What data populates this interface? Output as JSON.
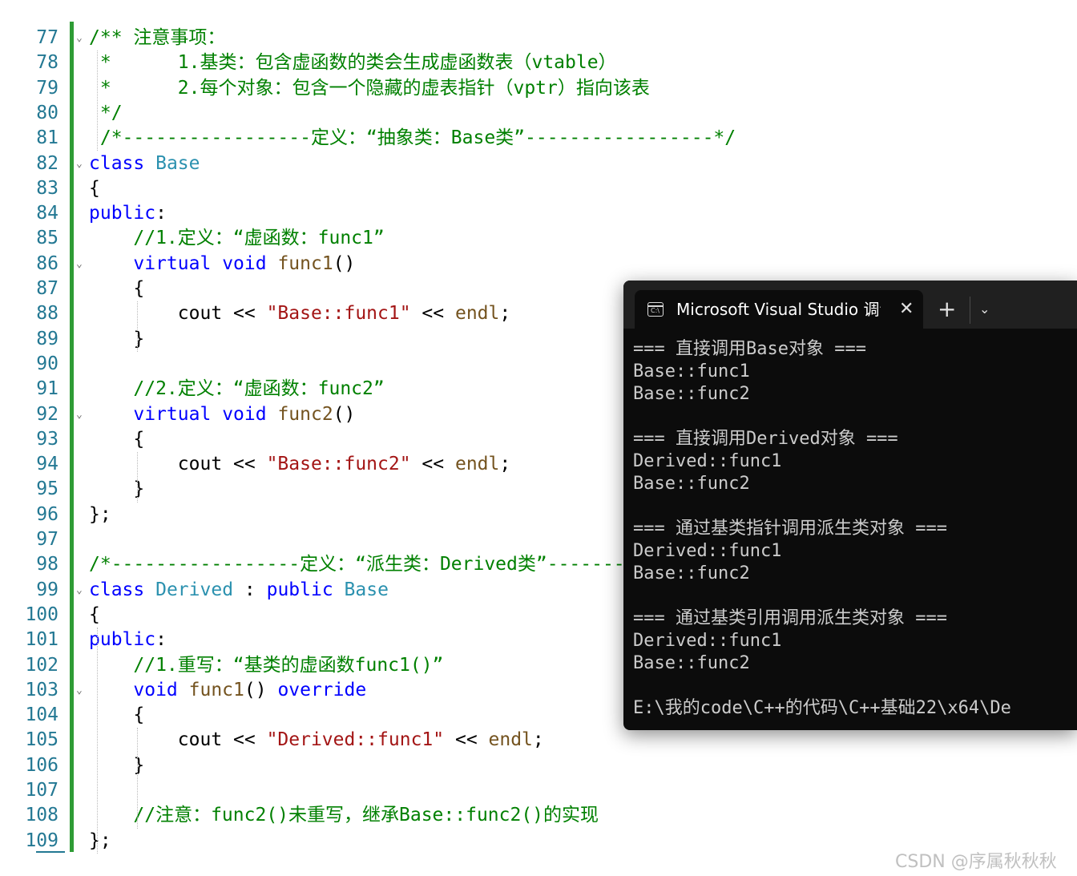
{
  "editor": {
    "lines": [
      {
        "num": "77",
        "fold": "⌄",
        "tokens": [
          {
            "t": "/** 注意事项：",
            "c": "com"
          }
        ]
      },
      {
        "num": "78",
        "fold": "",
        "tokens": [
          {
            "t": " *      1.基类：包含虚函数的类会生成虚函数表（vtable）",
            "c": "com"
          }
        ]
      },
      {
        "num": "79",
        "fold": "",
        "tokens": [
          {
            "t": " *      2.每个对象：包含一个隐藏的虚表指针（vptr）指向该表",
            "c": "com"
          }
        ]
      },
      {
        "num": "80",
        "fold": "",
        "tokens": [
          {
            "t": " */",
            "c": "com"
          }
        ]
      },
      {
        "num": "81",
        "fold": "",
        "tokens": [
          {
            "t": " /*-----------------定义：“抽象类：Base类”-----------------*/",
            "c": "com"
          }
        ]
      },
      {
        "num": "82",
        "fold": "⌄",
        "tokens": [
          {
            "t": "class",
            "c": "kw"
          },
          {
            "t": " ",
            "c": "pl"
          },
          {
            "t": "Base",
            "c": "typ"
          }
        ]
      },
      {
        "num": "83",
        "fold": "",
        "tokens": [
          {
            "t": "{",
            "c": "pl"
          }
        ]
      },
      {
        "num": "84",
        "fold": "",
        "tokens": [
          {
            "t": "public",
            "c": "kw"
          },
          {
            "t": ":",
            "c": "pl"
          }
        ]
      },
      {
        "num": "85",
        "fold": "",
        "tokens": [
          {
            "t": "    //1.定义：“虚函数：func1”",
            "c": "com"
          }
        ]
      },
      {
        "num": "86",
        "fold": "⌄",
        "tokens": [
          {
            "t": "    ",
            "c": "pl"
          },
          {
            "t": "virtual",
            "c": "kw"
          },
          {
            "t": " ",
            "c": "pl"
          },
          {
            "t": "void",
            "c": "kw"
          },
          {
            "t": " ",
            "c": "pl"
          },
          {
            "t": "func1",
            "c": "fn"
          },
          {
            "t": "()",
            "c": "pl"
          }
        ]
      },
      {
        "num": "87",
        "fold": "",
        "tokens": [
          {
            "t": "    {",
            "c": "pl"
          }
        ]
      },
      {
        "num": "88",
        "fold": "",
        "tokens": [
          {
            "t": "        cout << ",
            "c": "pl"
          },
          {
            "t": "\"Base::func1\"",
            "c": "str"
          },
          {
            "t": " << ",
            "c": "pl"
          },
          {
            "t": "endl",
            "c": "fn"
          },
          {
            "t": ";",
            "c": "pl"
          }
        ]
      },
      {
        "num": "89",
        "fold": "",
        "tokens": [
          {
            "t": "    }",
            "c": "pl"
          }
        ]
      },
      {
        "num": "90",
        "fold": "",
        "tokens": []
      },
      {
        "num": "91",
        "fold": "",
        "tokens": [
          {
            "t": "    //2.定义：“虚函数：func2”",
            "c": "com"
          }
        ]
      },
      {
        "num": "92",
        "fold": "⌄",
        "tokens": [
          {
            "t": "    ",
            "c": "pl"
          },
          {
            "t": "virtual",
            "c": "kw"
          },
          {
            "t": " ",
            "c": "pl"
          },
          {
            "t": "void",
            "c": "kw"
          },
          {
            "t": " ",
            "c": "pl"
          },
          {
            "t": "func2",
            "c": "fn"
          },
          {
            "t": "()",
            "c": "pl"
          }
        ]
      },
      {
        "num": "93",
        "fold": "",
        "tokens": [
          {
            "t": "    {",
            "c": "pl"
          }
        ]
      },
      {
        "num": "94",
        "fold": "",
        "tokens": [
          {
            "t": "        cout << ",
            "c": "pl"
          },
          {
            "t": "\"Base::func2\"",
            "c": "str"
          },
          {
            "t": " << ",
            "c": "pl"
          },
          {
            "t": "endl",
            "c": "fn"
          },
          {
            "t": ";",
            "c": "pl"
          }
        ]
      },
      {
        "num": "95",
        "fold": "",
        "tokens": [
          {
            "t": "    }",
            "c": "pl"
          }
        ]
      },
      {
        "num": "96",
        "fold": "",
        "tokens": [
          {
            "t": "};",
            "c": "pl"
          }
        ]
      },
      {
        "num": "97",
        "fold": "",
        "tokens": []
      },
      {
        "num": "98",
        "fold": "",
        "tokens": [
          {
            "t": "/*-----------------定义：“派生类：Derived类”-----------------*/",
            "c": "com"
          }
        ]
      },
      {
        "num": "99",
        "fold": "⌄",
        "tokens": [
          {
            "t": "class",
            "c": "kw"
          },
          {
            "t": " ",
            "c": "pl"
          },
          {
            "t": "Derived",
            "c": "typ"
          },
          {
            "t": " : ",
            "c": "pl"
          },
          {
            "t": "public",
            "c": "kw"
          },
          {
            "t": " ",
            "c": "pl"
          },
          {
            "t": "Base",
            "c": "typ"
          }
        ]
      },
      {
        "num": "100",
        "fold": "",
        "tokens": [
          {
            "t": "{",
            "c": "pl"
          }
        ]
      },
      {
        "num": "101",
        "fold": "",
        "tokens": [
          {
            "t": "public",
            "c": "kw"
          },
          {
            "t": ":",
            "c": "pl"
          }
        ]
      },
      {
        "num": "102",
        "fold": "",
        "tokens": [
          {
            "t": "    //1.重写：“基类的虚函数func1()”",
            "c": "com"
          }
        ]
      },
      {
        "num": "103",
        "fold": "⌄",
        "tokens": [
          {
            "t": "    ",
            "c": "pl"
          },
          {
            "t": "void",
            "c": "kw"
          },
          {
            "t": " ",
            "c": "pl"
          },
          {
            "t": "func1",
            "c": "fn"
          },
          {
            "t": "() ",
            "c": "pl"
          },
          {
            "t": "override",
            "c": "kw"
          }
        ]
      },
      {
        "num": "104",
        "fold": "",
        "tokens": [
          {
            "t": "    {",
            "c": "pl"
          }
        ]
      },
      {
        "num": "105",
        "fold": "",
        "tokens": [
          {
            "t": "        cout << ",
            "c": "pl"
          },
          {
            "t": "\"Derived::func1\"",
            "c": "str"
          },
          {
            "t": " << ",
            "c": "pl"
          },
          {
            "t": "endl",
            "c": "fn"
          },
          {
            "t": ";",
            "c": "pl"
          }
        ]
      },
      {
        "num": "106",
        "fold": "",
        "tokens": [
          {
            "t": "    }",
            "c": "pl"
          }
        ]
      },
      {
        "num": "107",
        "fold": "",
        "tokens": []
      },
      {
        "num": "108",
        "fold": "",
        "tokens": [
          {
            "t": "    //注意：func2()未重写，继承Base::func2()的实现",
            "c": "com"
          }
        ]
      },
      {
        "num": "109",
        "fold": "",
        "tokens": [
          {
            "t": "};",
            "c": "pl"
          }
        ]
      }
    ]
  },
  "terminal": {
    "tab_title": "Microsoft Visual Studio 调试控制台",
    "tab_icon_text": "C:\\",
    "close_glyph": "✕",
    "new_tab_glyph": "+",
    "dropdown_glyph": "⌄",
    "output": [
      "=== 直接调用Base对象 ===",
      "Base::func1",
      "Base::func2",
      "",
      "=== 直接调用Derived对象 ===",
      "Derived::func1",
      "Base::func2",
      "",
      "=== 通过基类指针调用派生类对象 ===",
      "Derived::func1",
      "Base::func2",
      "",
      "=== 通过基类引用调用派生类对象 ===",
      "Derived::func1",
      "Base::func2",
      "",
      "E:\\我的code\\C++的代码\\C++基础22\\x64\\De"
    ]
  },
  "watermark": "CSDN @序属秋秋秋"
}
